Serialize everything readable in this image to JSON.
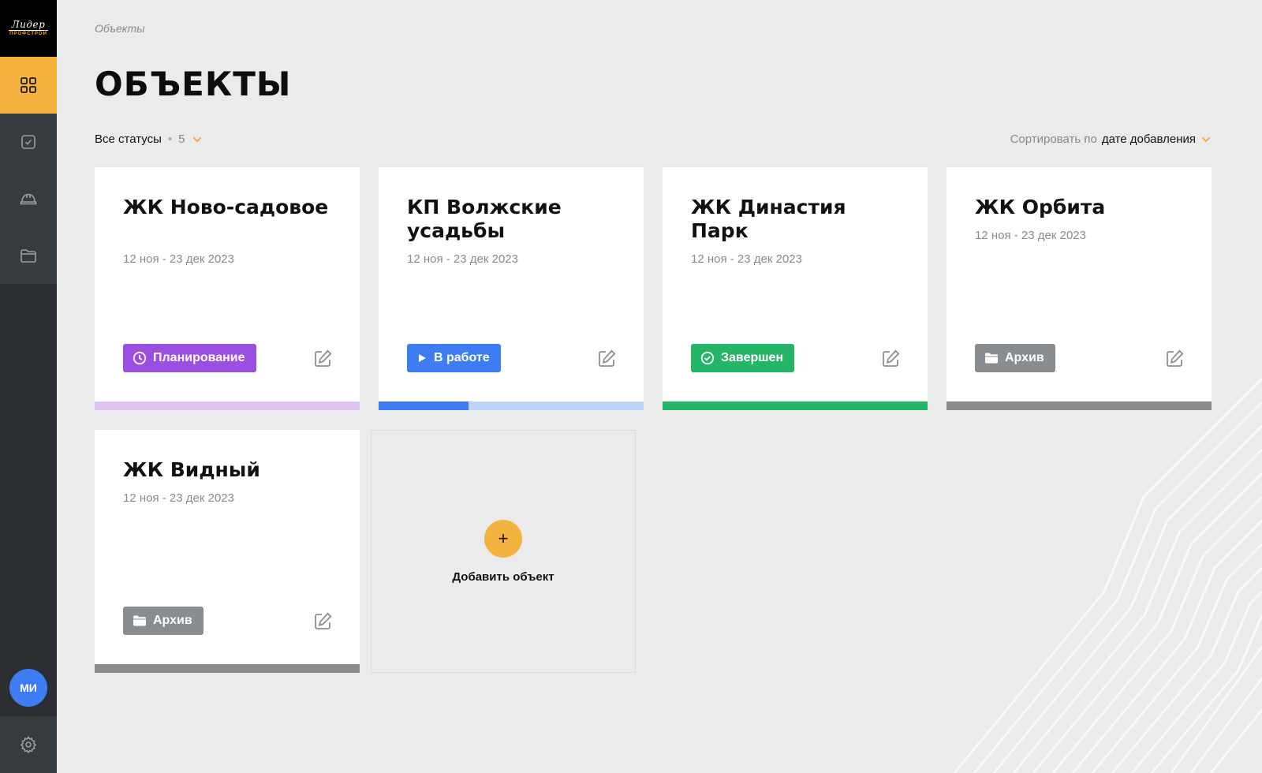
{
  "logo": {
    "top": "Лидер",
    "bottom": "ПРОФСТРОЙ"
  },
  "sidebar": {
    "items": [
      {
        "name": "grid",
        "icon": "grid-icon",
        "active": true
      },
      {
        "name": "tasks",
        "icon": "checkbox-icon",
        "active": false
      },
      {
        "name": "helmet",
        "icon": "helmet-icon",
        "active": false
      },
      {
        "name": "folder",
        "icon": "folder-icon",
        "active": false
      }
    ],
    "avatar": "МИ",
    "settings_icon": "gear-icon"
  },
  "breadcrumb": "Объекты",
  "page_title": "ОБЪЕКТЫ",
  "filter": {
    "label": "Все статусы",
    "separator": "•",
    "count": "5"
  },
  "sort": {
    "label": "Сортировать по",
    "value": "дате добавления"
  },
  "cards": [
    {
      "title": "ЖК Ново-садовое",
      "dates": "12 ноя - 23 дек 2023",
      "status": "Планирование",
      "status_icon": "clock-icon",
      "status_color": "#9b4fe0",
      "progress_bg": "#dcc3f2",
      "progress_fill": "#dcc3f2",
      "progress": 0
    },
    {
      "title": "КП Волжские усадьбы",
      "dates": "12 ноя - 23 дек 2023",
      "status": "В работе",
      "status_icon": "play-icon",
      "status_color": "#3d7cf2",
      "progress_bg": "#bcd2f8",
      "progress_fill": "#3d7cf2",
      "progress": 0.34
    },
    {
      "title": "ЖК Династия Парк",
      "dates": "12 ноя - 23 дек 2023",
      "status": "Завершен",
      "status_icon": "check-circle-icon",
      "status_color": "#25b567",
      "progress_bg": "#25b567",
      "progress_fill": "#25b567",
      "progress": 1
    },
    {
      "title": "ЖК Орбита",
      "dates": "12 ноя - 23 дек 2023",
      "status": "Архив",
      "status_icon": "folder-icon",
      "status_color": "#8a8d90",
      "progress_bg": "#8a8d90",
      "progress_fill": "#8a8d90",
      "progress": 1
    },
    {
      "title": "ЖК Видный",
      "dates": "12 ноя - 23 дек 2023",
      "status": "Архив",
      "status_icon": "folder-icon",
      "status_color": "#8a8d90",
      "progress_bg": "#8a8d90",
      "progress_fill": "#8a8d90",
      "progress": 1
    }
  ],
  "add_card": {
    "icon": "+",
    "label": "Добавить объект"
  },
  "colors": {
    "accent": "#f4b23e",
    "sidebar": "#2b2f33",
    "background": "#ebebeb"
  }
}
